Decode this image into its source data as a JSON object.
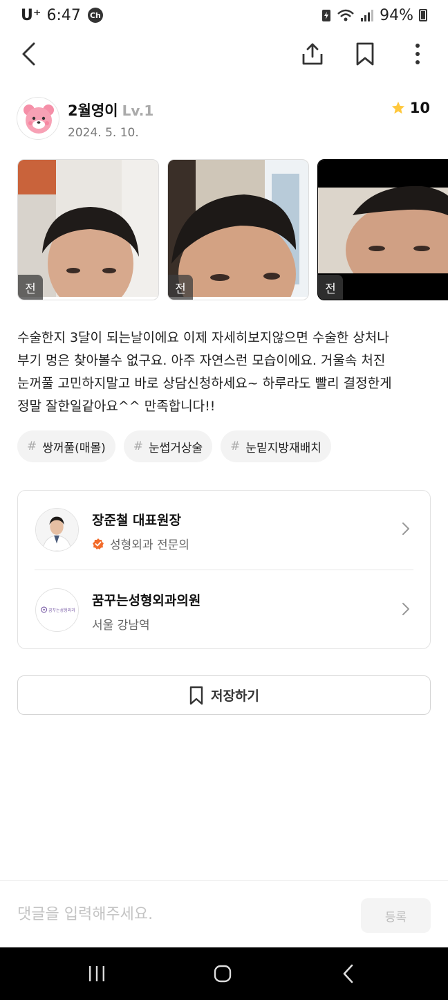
{
  "status_bar": {
    "carrier": "U⁺",
    "time": "6:47",
    "chat_badge": "Ch",
    "battery": "94%"
  },
  "icons": {
    "back": "chevron-left-icon",
    "share": "share-icon",
    "bookmark": "bookmark-icon",
    "more": "more-vertical-icon"
  },
  "author": {
    "name": "2월영이",
    "level": "Lv.1",
    "date": "2024. 5. 10.",
    "rating": "10"
  },
  "photos": [
    {
      "label": "전"
    },
    {
      "label": "전"
    },
    {
      "label": "전"
    }
  ],
  "post": {
    "text": "수술한지 3달이 되는날이에요 이제 자세히보지않으면 수술한 상처나\n부기 멍은 찾아볼수 없구요. 아주 자연스런 모습이에요. 거울속 처진\n눈꺼풀 고민하지말고 바로 상담신청하세요~ 하루라도 빨리 결정한게\n정말 잘한일같아요^^  만족합니다!!"
  },
  "hashtags": [
    {
      "hash": "#",
      "label": "쌍꺼풀(매몰)"
    },
    {
      "hash": "#",
      "label": "눈썹거상술"
    },
    {
      "hash": "#",
      "label": "눈밑지방재배치"
    }
  ],
  "doctor": {
    "name": "장준철 대표원장",
    "specialty": "성형외과 전문의"
  },
  "clinic": {
    "name": "꿈꾸는성형외과의원",
    "location": "서울 강남역",
    "logo_text": "꿈꾸는성형외과"
  },
  "save_button": {
    "label": "저장하기"
  },
  "comment": {
    "placeholder": "댓글을 입력해주세요.",
    "submit_label": "등록"
  },
  "colors": {
    "star": "#FFC83D",
    "verified": "#F26B2A",
    "border": "#E2E2E2"
  }
}
